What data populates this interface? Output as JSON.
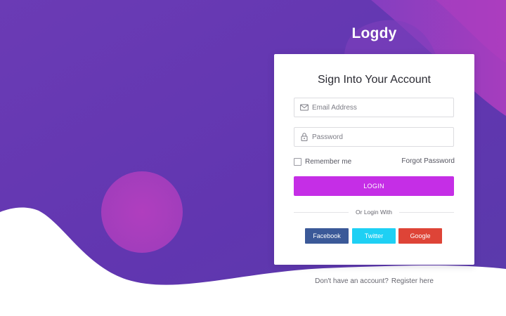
{
  "brand": {
    "name": "Logdy"
  },
  "login_card": {
    "title": "Sign Into Your Account",
    "email": {
      "icon": "envelope-icon",
      "placeholder": "Email Address",
      "value": ""
    },
    "password": {
      "icon": "lock-icon",
      "placeholder": "Password",
      "value": ""
    },
    "remember_me": {
      "label": "Remember me",
      "checked": false
    },
    "forgot_password": "Forgot Password",
    "login_button": "LOGIN",
    "divider_text": "Or Login With",
    "social": [
      {
        "label": "Facebook",
        "color": "#3b5998"
      },
      {
        "label": "Twitter",
        "color": "#1ed0f4"
      },
      {
        "label": "Google",
        "color": "#de4437"
      }
    ]
  },
  "footer": {
    "prompt": "Don't have an account?",
    "register_link": "Register here"
  },
  "colors": {
    "background_gradient_start": "#6b3bb5",
    "background_gradient_end": "#5a3aab",
    "accent": "#c52ee6",
    "circle": "#b03ec0"
  }
}
